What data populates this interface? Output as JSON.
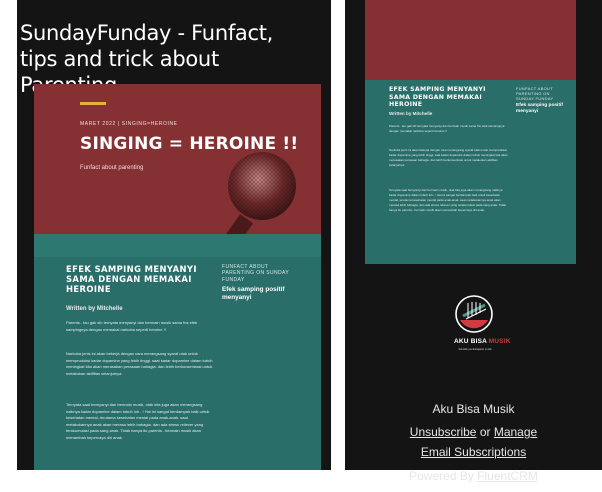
{
  "left": {
    "title": "SundayFunday - Funfact, tips and trick about Parenting",
    "hero": {
      "meta": "MARET 2022 | SINGING=HEROINE",
      "headline": "SINGING = HEROINE !!",
      "subtitle": "Funfact about parenting"
    },
    "article": {
      "title": "EFEK SAMPING MENYANYI SAMA DENGAN MEMAKAI HEROINE",
      "author": "Written by Mitchelle",
      "side_kicker": "FUNFACT ABOUT PARENTING ON SUNDAY FUNDAY",
      "side_title": "Efek samping positif menyanyi",
      "paragraphs": [
        "Parents.. tau gak sih ternyata menyanyi dan bermain musik sama fns efek sampingnya dengan memakai narkoba seperti heroine !!",
        "Narkoba jenis ini akan bekerja dengan cara merangsang syaraf otak untuk memproduksi kadar dopamine yang lebih tinggi. saat kadar dopamine dalam tubuh meningkat kita akan merasakan perasaan bahagia. dan lebih berkonsentrasi untuk melakukan aktifitas selanjutnya.",
        "Ternyata saat bernyanyi dan bermain musik, otak kita juga akan merangsang naiknya kadar dopamine dalam tubuh loh.. ! Hal ini sangat berdampak baik untuk kesehatan mental, terutama kesehatan mental pada anak-anak. saat melakukannya anak akan merasa lebih bahagia. dan ada stress reliever yang terakumulasi pada sang anak. Tidak hanya itu parents.. bermain musik akan menambah kepercaya diri anak."
      ]
    }
  },
  "right": {
    "article": {
      "title": "EFEK SAMPING MENYANYI SAMA DENGAN MEMAKAI HEROINE",
      "author": "Written by Mitchelle",
      "side_kicker": "FUNFACT ABOUT PARENTING ON SUNDAY FUNDAY",
      "side_title": "Efek samping positif menyanyi",
      "paragraphs": [
        "Parents.. tau gak sih ternyata menyanyi dan bermain musik sama fns efek sampingnya dengan memakai narkoba seperti heroine !!",
        "Narkoba jenis ini akan bekerja dengan cara merangsang syaraf otak untuk memproduksi kadar dopamine yang lebih tinggi. saat kadar dopamine dalam tubuh meningkat kita akan merasakan perasaan bahagia. dan lebih berkonsentrasi untuk melakukan aktifitas selanjutnya.",
        "Ternyata saat bernyanyi dan bermain musik, otak kita juga akan merangsang naiknya kadar dopamine dalam tubuh loh.. ! Hal ini sangat berdampak baik untuk kesehatan mental, terutama kesehatan mental pada anak-anak. saat melakukannya anak akan merasa lebih bahagia. dan ada stress reliever yang terakumulasi pada sang anak. Tidak hanya itu parents.. bermain musik akan menambah kepercaya diri anak."
      ]
    },
    "logo": {
      "name_main": "AKU BISA ",
      "name_accent": "MUSIK",
      "tagline": "Sekolah pembelajaran musik"
    },
    "footer": {
      "company": "Aku Bisa Musik",
      "unsubscribe": "Unsubscribe",
      "or": " or ",
      "manage": "Manage Email Subscriptions",
      "powered_prefix": "Powered By ",
      "powered_link": "FluentCRM"
    }
  },
  "colors": {
    "background": "#141414",
    "hero_red": "#853032",
    "teal": "#2a6e69",
    "gold_bar": "#e3b23c",
    "logo_red": "#d13b3f"
  }
}
